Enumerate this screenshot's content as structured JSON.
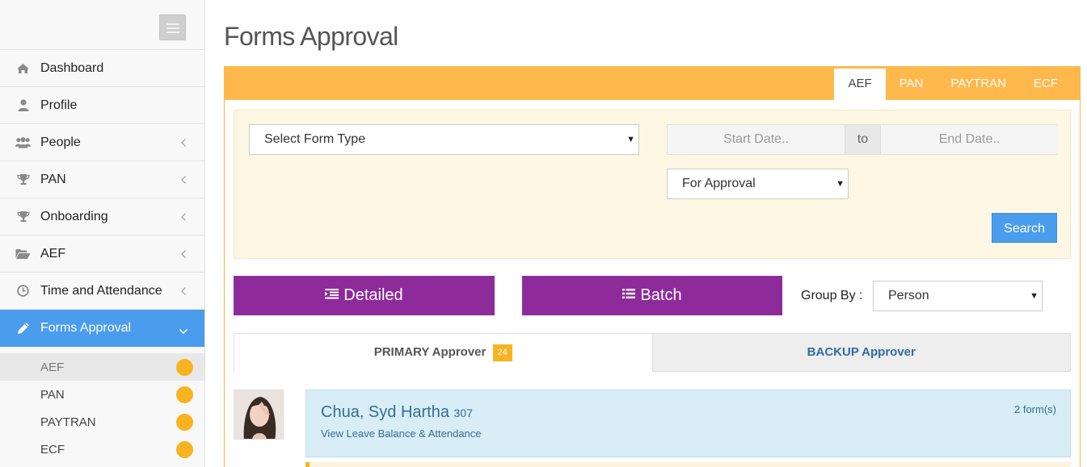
{
  "sidebar": {
    "items": [
      {
        "label": "Dashboard",
        "icon": "home-icon"
      },
      {
        "label": "Profile",
        "icon": "user-icon"
      },
      {
        "label": "People",
        "icon": "users-icon"
      },
      {
        "label": "PAN",
        "icon": "trophy-icon"
      },
      {
        "label": "Onboarding",
        "icon": "trophy-icon"
      },
      {
        "label": "AEF",
        "icon": "folder-open-icon"
      },
      {
        "label": "Time and Attendance",
        "icon": "clock-icon"
      },
      {
        "label": "Forms Approval",
        "icon": "pencil-icon"
      }
    ],
    "sub_items": [
      {
        "label": "AEF"
      },
      {
        "label": "PAN"
      },
      {
        "label": "PAYTRAN"
      },
      {
        "label": "ECF"
      }
    ]
  },
  "page": {
    "title": "Forms Approval"
  },
  "tabs": [
    "AEF",
    "PAN",
    "PAYTRAN",
    "ECF"
  ],
  "filters": {
    "form_type": "Select Form Type",
    "start_date_placeholder": "Start Date..",
    "to_label": "to",
    "end_date_placeholder": "End Date..",
    "status": "For Approval",
    "search_label": "Search"
  },
  "view": {
    "detailed_label": "Detailed",
    "batch_label": "Batch",
    "group_by_label": "Group By :",
    "group_by_value": "Person"
  },
  "approver": {
    "primary_label": "PRIMARY Approver",
    "primary_count": "24",
    "backup_label": "BACKUP Approver"
  },
  "person": {
    "name": "Chua, Syd Hartha",
    "id": "307",
    "link": "View Leave Balance & Attendance",
    "forms": "2 form(s)"
  },
  "colors": {
    "accent_blue": "#4a9ced",
    "orange": "#ffb84c",
    "purple": "#8e2b9b",
    "badge": "#f9b320"
  }
}
